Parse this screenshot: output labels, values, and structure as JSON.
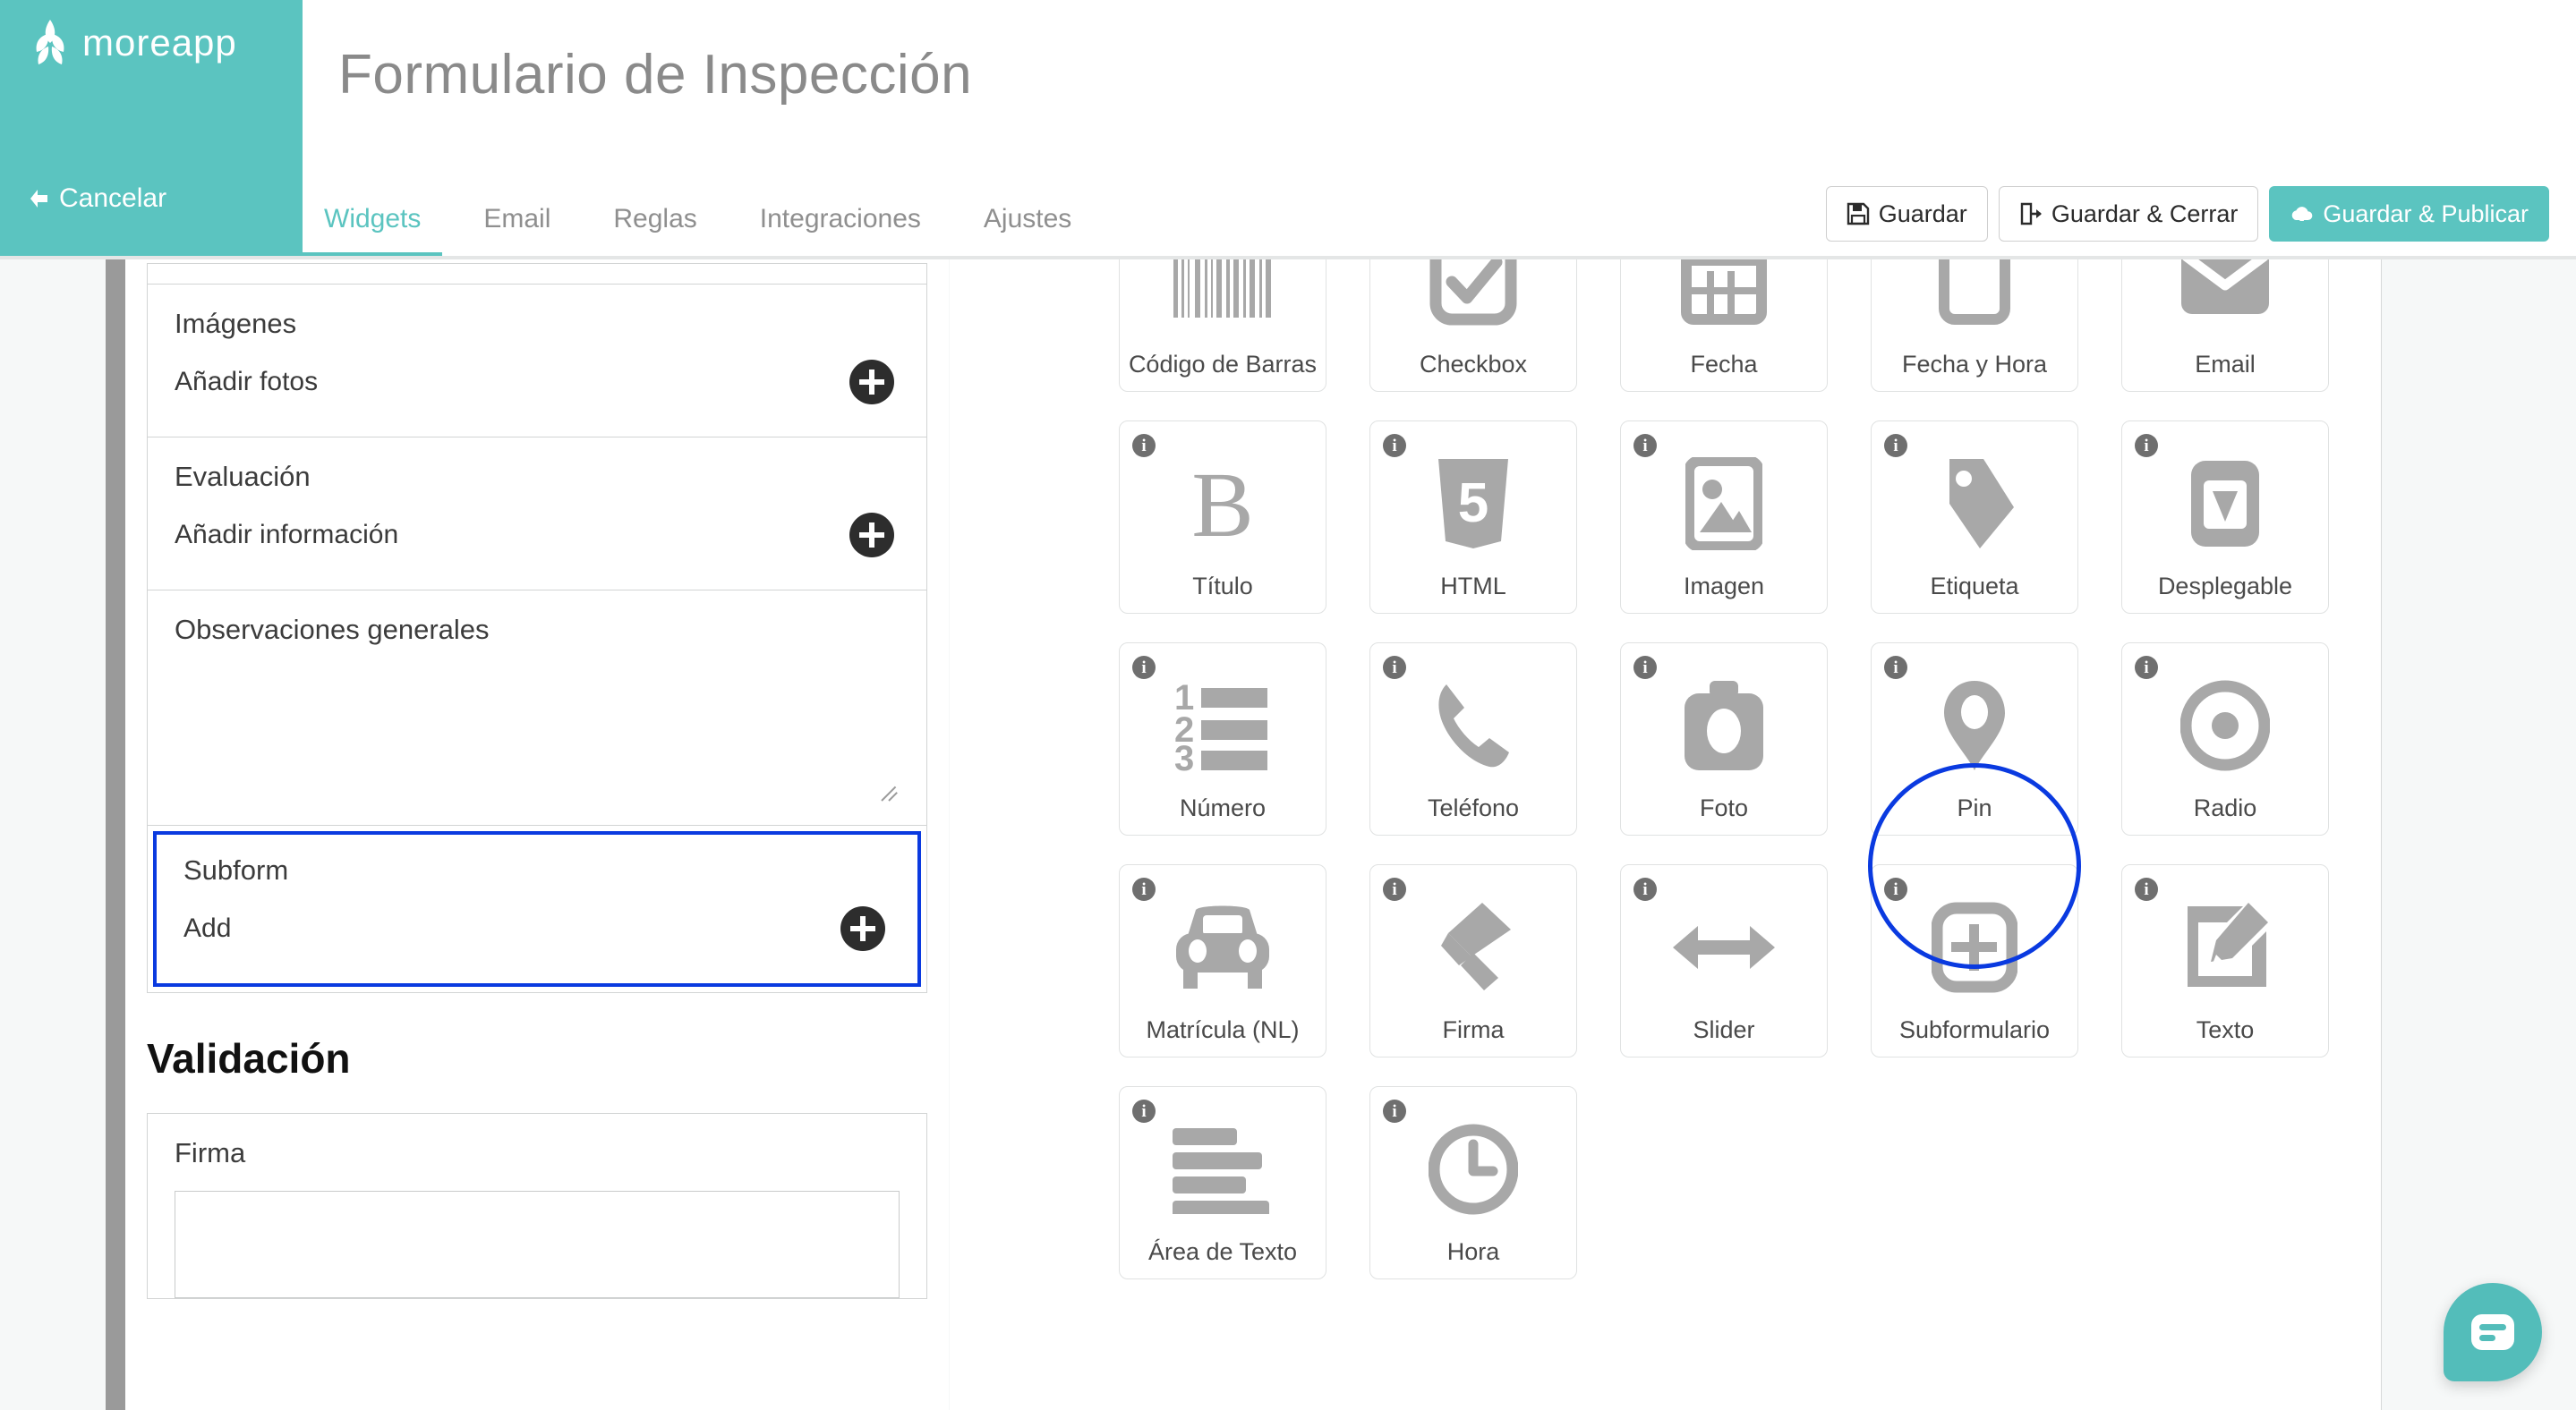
{
  "brand": {
    "name": "moreapp",
    "logo_icon": "wheat-leaf-icon"
  },
  "header": {
    "title": "Formulario de Inspección",
    "cancel_label": "Cancelar",
    "cancel_icon": "arrow-left-icon",
    "tabs": [
      {
        "label": "Widgets",
        "active": true
      },
      {
        "label": "Email",
        "active": false
      },
      {
        "label": "Reglas",
        "active": false
      },
      {
        "label": "Integraciones",
        "active": false
      },
      {
        "label": "Ajustes",
        "active": false
      }
    ],
    "actions": [
      {
        "label": "Guardar",
        "icon": "save-floppy-icon",
        "primary": false
      },
      {
        "label": "Guardar & Cerrar",
        "icon": "exit-door-icon",
        "primary": false
      },
      {
        "label": "Guardar & Publicar",
        "icon": "cloud-upload-icon",
        "primary": true
      }
    ]
  },
  "editor": {
    "fields": [
      {
        "label": "Imágenes",
        "sub": "Añadir fotos",
        "type": "photo",
        "selected": false
      },
      {
        "label": "Evaluación",
        "sub": "Añadir información",
        "type": "subform",
        "selected": false
      },
      {
        "label": "Observaciones generales",
        "sub": "",
        "type": "textarea",
        "selected": false
      },
      {
        "label": "Subform",
        "sub": "Add",
        "type": "subform",
        "selected": true
      }
    ],
    "validation_heading": "Validación",
    "validation_field_label": "Firma"
  },
  "widgets": {
    "items": [
      {
        "label": "Código de Barras",
        "icon": "barcode-icon"
      },
      {
        "label": "Checkbox",
        "icon": "checkbox-icon"
      },
      {
        "label": "Fecha",
        "icon": "calendar-icon"
      },
      {
        "label": "Fecha y Hora",
        "icon": "calendar-clock-icon"
      },
      {
        "label": "Email",
        "icon": "envelope-icon"
      },
      {
        "label": "Título",
        "icon": "letter-b-icon"
      },
      {
        "label": "HTML",
        "icon": "html5-icon"
      },
      {
        "label": "Imagen",
        "icon": "picture-icon"
      },
      {
        "label": "Etiqueta",
        "icon": "tag-icon"
      },
      {
        "label": "Desplegable",
        "icon": "dropdown-icon"
      },
      {
        "label": "Número",
        "icon": "numbered-list-icon"
      },
      {
        "label": "Teléfono",
        "icon": "phone-icon"
      },
      {
        "label": "Foto",
        "icon": "camera-icon"
      },
      {
        "label": "Pin",
        "icon": "map-pin-icon"
      },
      {
        "label": "Radio",
        "icon": "radio-button-icon"
      },
      {
        "label": "Matrícula (NL)",
        "icon": "car-icon"
      },
      {
        "label": "Firma",
        "icon": "signature-pen-icon"
      },
      {
        "label": "Slider",
        "icon": "double-arrow-icon"
      },
      {
        "label": "Subformulario",
        "icon": "plus-square-icon"
      },
      {
        "label": "Texto",
        "icon": "pencil-edit-icon"
      },
      {
        "label": "Área de Texto",
        "icon": "text-lines-icon"
      },
      {
        "label": "Hora",
        "icon": "clock-icon"
      }
    ],
    "info_badge": "i",
    "highlighted_label": "Subformulario"
  },
  "chat": {
    "icon": "chat-bubble-icon"
  },
  "colors": {
    "brand_teal": "#5bc4c0",
    "highlight_blue": "#0a3ae0",
    "icon_gray": "#a8a8a8",
    "panel_bg": "#f6f8f8"
  }
}
